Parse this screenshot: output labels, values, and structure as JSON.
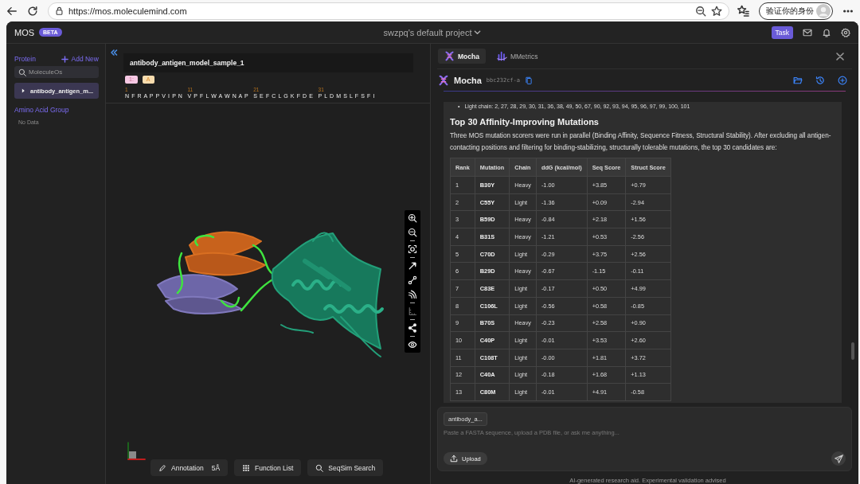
{
  "browser": {
    "url": "https://mos.moleculemind.com",
    "profile_label": "验证你的身份"
  },
  "app": {
    "brand": "MOS",
    "badge": "BETA",
    "project_title": "swzpq's default project",
    "task_button": "Task"
  },
  "sidebar": {
    "section_title": "Protein",
    "add_label": "Add New",
    "search": {
      "placeholder": "MoleculeOs"
    },
    "items": [
      {
        "label": "antibody_antigen_m...",
        "selected": true,
        "expanded": false
      }
    ],
    "group_title": "Amino Acid Group",
    "empty_text": "No Data"
  },
  "viewer": {
    "title": "antibody_antigen_model_sample_1",
    "chains": [
      {
        "label": "1:",
        "color": "#f7c8e4"
      },
      {
        "label": "A",
        "color": "#f8dcae"
      }
    ],
    "sequence": [
      {
        "start": "1",
        "residues": "N F R A P P V I P N"
      },
      {
        "start": "11",
        "residues": "V P F L W A W N A P"
      },
      {
        "start": "21",
        "residues": "S E F C L G K F D E"
      },
      {
        "start": "31",
        "residues": "P L D M S L F S F I"
      }
    ],
    "tool_groups": [
      {
        "tools": [
          {
            "kind": "zoom_in",
            "disabled": false
          },
          {
            "kind": "zoom_out",
            "disabled": false
          }
        ]
      },
      {
        "tools": [
          {
            "kind": "focus",
            "disabled": false
          }
        ]
      },
      {
        "tools": [
          {
            "kind": "pointer",
            "disabled": false
          },
          {
            "kind": "link",
            "disabled": false
          },
          {
            "kind": "wave",
            "disabled": false
          }
        ]
      },
      {
        "tools": [
          {
            "kind": "ruler",
            "disabled": true
          }
        ]
      },
      {
        "tools": [
          {
            "kind": "share",
            "disabled": false
          }
        ]
      },
      {
        "tools": [
          {
            "kind": "eye",
            "disabled": false
          }
        ]
      }
    ],
    "buttons": [
      {
        "kind": "annotation",
        "label": "Annotation",
        "suffix": "5Å"
      },
      {
        "kind": "functions",
        "label": "Function List"
      },
      {
        "kind": "search",
        "label": "SeqSim Search"
      }
    ]
  },
  "assistant": {
    "tabs": [
      {
        "kind": "mocha",
        "label": "Mocha",
        "selected": true
      },
      {
        "kind": "metrics",
        "label": "MMetrics",
        "selected": false
      }
    ],
    "header": {
      "name": "Mocha",
      "session_id": "bbc232cf-a"
    },
    "content": {
      "bullet_marker": "•",
      "bullet": "Light chain: 2, 27, 28, 29, 30, 31, 36, 38, 49, 50, 67, 90, 92, 93, 94, 95, 96, 97, 99, 100, 101",
      "heading": "Top 30 Affinity-Improving Mutations",
      "paragraph": "Three MOS mutation scorers were run in parallel (Binding Affinity, Sequence Fitness, Structural Stability). After excluding all antigen-contacting positions and filtering for binding-stabilizing, structurally tolerable mutations, the top 30 candidates are:",
      "table": {
        "columns": [
          "Rank",
          "Mutation",
          "Chain",
          "ddG (kcal/mol)",
          "Seq Score",
          "Struct Score"
        ],
        "rows": [
          [
            "1",
            "B30Y",
            "Heavy",
            "-1.00",
            "+3.85",
            "+0.79"
          ],
          [
            "2",
            "C55Y",
            "Light",
            "-1.36",
            "+0.09",
            "-2.94"
          ],
          [
            "3",
            "B59D",
            "Heavy",
            "-0.84",
            "+2.18",
            "+1.56"
          ],
          [
            "4",
            "B31S",
            "Heavy",
            "-1.21",
            "+0.53",
            "-2.56"
          ],
          [
            "5",
            "C70D",
            "Light",
            "-0.29",
            "+3.75",
            "+2.56"
          ],
          [
            "6",
            "B29D",
            "Heavy",
            "-0.67",
            "-1.15",
            "-0.11"
          ],
          [
            "7",
            "C83E",
            "Light",
            "-0.17",
            "+0.50",
            "+4.99"
          ],
          [
            "8",
            "C106L",
            "Light",
            "-0.56",
            "+0.58",
            "-0.85"
          ],
          [
            "9",
            "B70S",
            "Heavy",
            "-0.23",
            "+2.58",
            "+0.90"
          ],
          [
            "10",
            "C40P",
            "Light",
            "-0.01",
            "+3.53",
            "+2.60"
          ],
          [
            "11",
            "C108T",
            "Light",
            "-0.00",
            "+1.81",
            "+3.72"
          ],
          [
            "12",
            "C40A",
            "Light",
            "-0.18",
            "+1.68",
            "+1.13"
          ],
          [
            "13",
            "C80M",
            "Light",
            "-0.01",
            "+4.91",
            "-0.58"
          ]
        ]
      }
    },
    "composer": {
      "chip": "antibody_a...",
      "placeholder": "Paste a FASTA sequence, upload a PDB file, or ask me anything...",
      "upload_label": "Upload"
    },
    "disclaimer": "AI-generated research aid. Experimental validation advised"
  }
}
